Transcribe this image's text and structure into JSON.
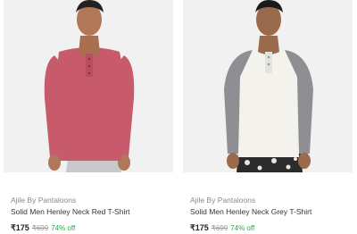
{
  "products": [
    {
      "brand": "Ajile By Pantaloons",
      "title": "Solid Men Henley Neck Red T-Shirt",
      "price": "₹175",
      "mrp": "₹699",
      "discount": "74% off",
      "image_icon": "product-image",
      "shirt_color": "#c75a6b"
    },
    {
      "brand": "Ajile By Pantaloons",
      "title": "Solid Men Henley Neck Grey T-Shirt",
      "price": "₹175",
      "mrp": "₹699",
      "discount": "74% off",
      "image_icon": "product-image",
      "shirt_color": "#f4f2ec",
      "sleeve_color": "#8e8f93"
    }
  ],
  "colors": {
    "image_bg": "#f1f1f1",
    "discount": "#27a844",
    "brand": "#8a8a8a"
  }
}
